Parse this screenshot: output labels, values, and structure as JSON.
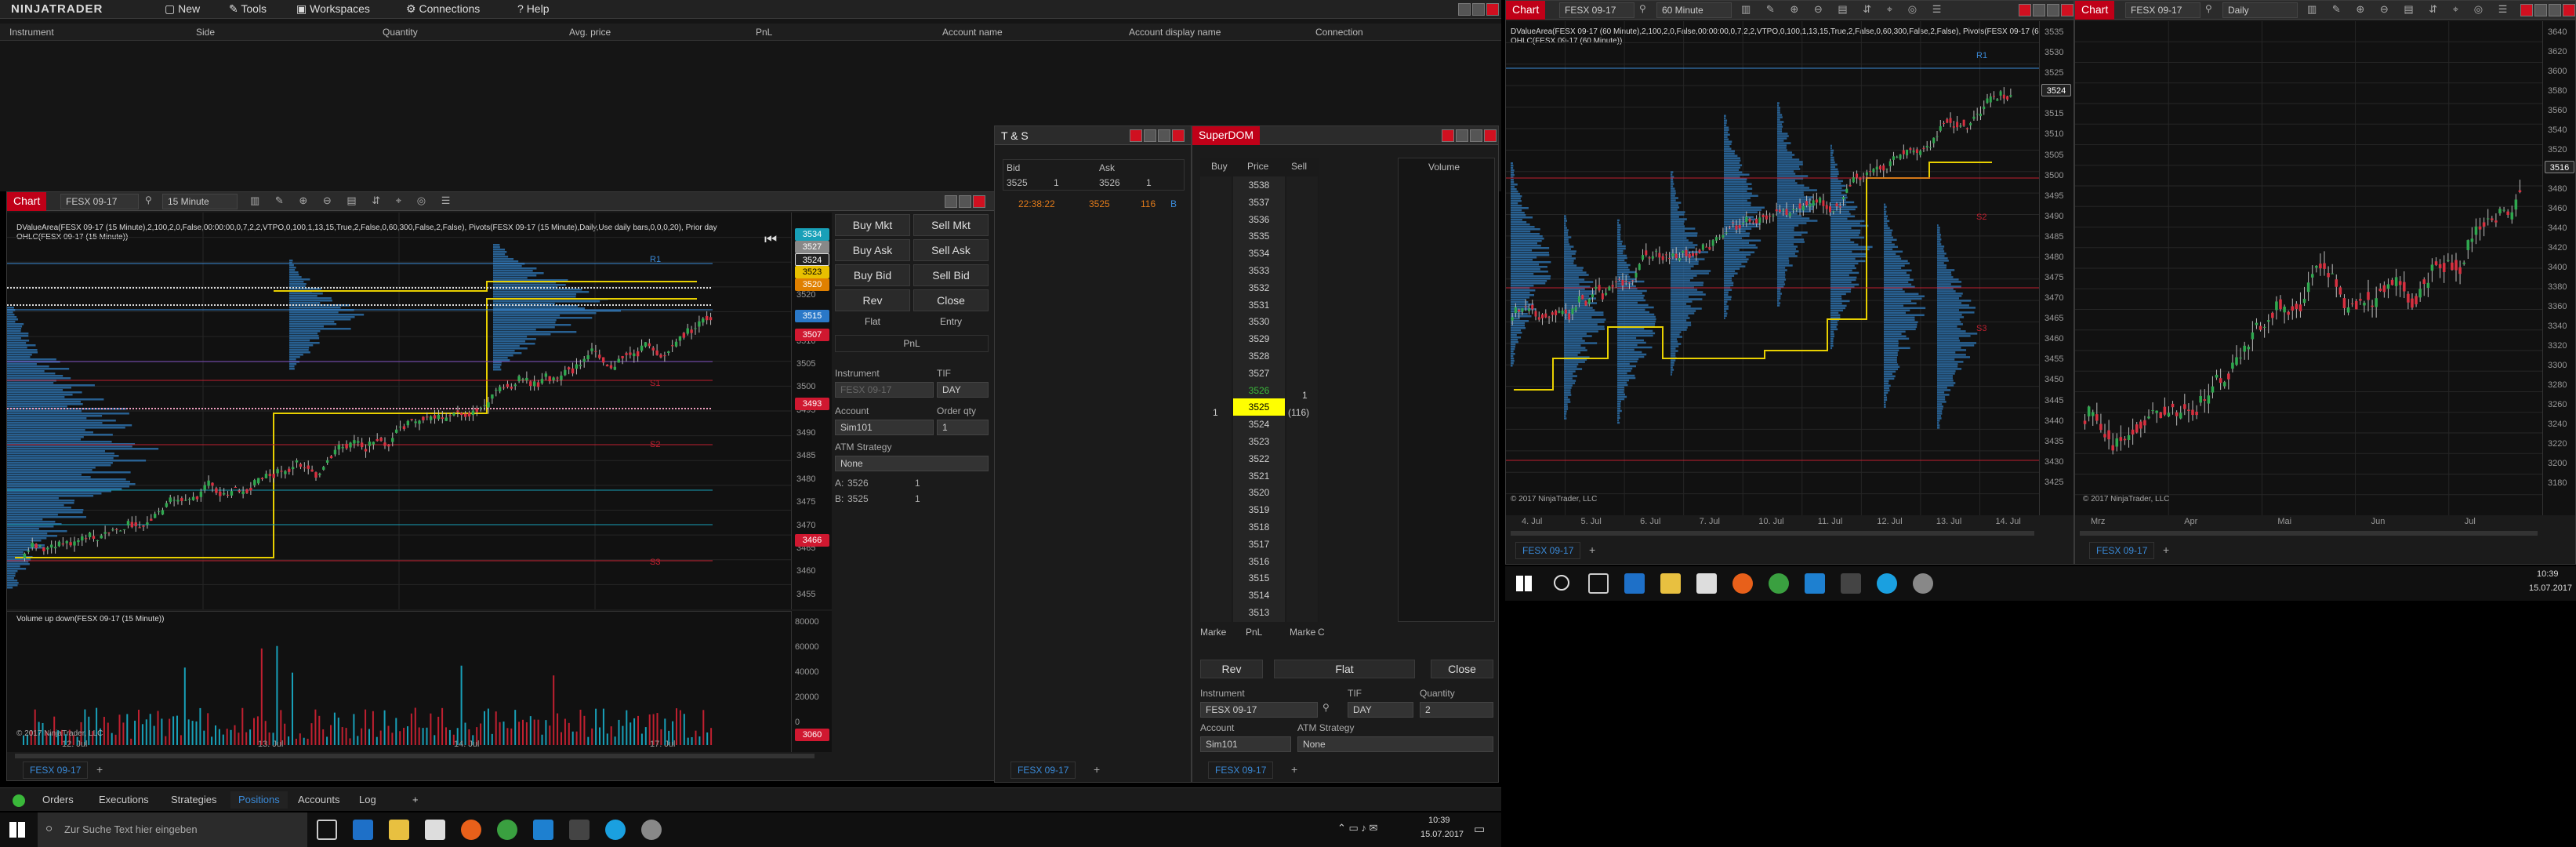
{
  "menu": {
    "brand": "NINJATRADER",
    "items": [
      "New",
      "Tools",
      "Workspaces",
      "Connections",
      "Help"
    ]
  },
  "positions": {
    "columns": [
      "Instrument",
      "Side",
      "Quantity",
      "Avg. price",
      "PnL",
      "Account name",
      "Account display name",
      "Connection"
    ]
  },
  "bottom_tabs": {
    "items": [
      "Orders",
      "Executions",
      "Strategies",
      "Positions",
      "Accounts",
      "Log"
    ],
    "active": "Positions",
    "add": "+"
  },
  "chart1": {
    "title": "Chart",
    "instrument": "FESX 09-17",
    "interval": "15 Minute",
    "indicator_line1": "DValueArea(FESX 09-17 (15 Minute),2,100,2,0,False,00:00:00,0,7,2,2,VTPO,0,100,1,13,15,True,2,False,0,60,300,False,2,False), Pivots(FESX 09-17 (15 Minute),Daily,Use daily bars,0,0,0,20), Prior day",
    "indicator_line2": "OHLC(FESX 09-17 (15 Minute))",
    "copyright": "© 2017 NinjaTrader, LLC",
    "volume_title": "Volume up down(FESX 09-17 (15 Minute))",
    "x_labels": [
      "12. Jul",
      "13. Jul",
      "14. Jul",
      "17. Jul"
    ],
    "y_labels": [
      "3530",
      "3525",
      "3520",
      "3515",
      "3510",
      "3505",
      "3500",
      "3495",
      "3490",
      "3485",
      "3480",
      "3475",
      "3470",
      "3465",
      "3460",
      "3455"
    ],
    "vol_labels": [
      "80000",
      "60000",
      "40000",
      "20000",
      "0"
    ],
    "price_tags": [
      {
        "v": "3534",
        "c": "#18a0b8"
      },
      {
        "v": "3527",
        "c": "#888"
      },
      {
        "v": "3524",
        "c": "#222"
      },
      {
        "v": "3523",
        "c": "#e8c000"
      },
      {
        "v": "3520",
        "c": "#e08000"
      },
      {
        "v": "3515",
        "c": "#2a78c8"
      },
      {
        "v": "3507",
        "c": "#d01830"
      },
      {
        "v": "3493",
        "c": "#d01830"
      },
      {
        "v": "3466",
        "c": "#d01830"
      },
      {
        "v": "3060",
        "c": "#d01830"
      }
    ],
    "pivots": [
      "R1",
      "S1",
      "S2",
      "S3"
    ],
    "tab": "FESX 09-17"
  },
  "order_panel": {
    "buttons": [
      "Buy Mkt",
      "Sell Mkt",
      "Buy Ask",
      "Sell Ask",
      "Buy Bid",
      "Sell Bid",
      "Rev",
      "Close"
    ],
    "flat": "Flat",
    "entry": "Entry",
    "pnl": "PnL",
    "instrument_label": "Instrument",
    "instrument": "FESX 09-17",
    "tif_label": "TIF",
    "tif": "DAY",
    "account_label": "Account",
    "account": "Sim101",
    "qty_label": "Order qty",
    "qty": "1",
    "atm_label": "ATM Strategy",
    "atm": "None",
    "a_label": "A:",
    "a_price": "3526",
    "a_qty": "1",
    "b_label": "B:",
    "b_price": "3525",
    "b_qty": "1"
  },
  "ts": {
    "title": "T & S",
    "bid_label": "Bid",
    "ask_label": "Ask",
    "bid": "3525",
    "bid_size": "1",
    "ask": "3526",
    "ask_size": "1",
    "trade_time": "22:38:22",
    "trade_price": "3525",
    "trade_size": "116",
    "trade_side": "B",
    "tab": "FESX 09-17"
  },
  "superdom": {
    "title": "SuperDOM",
    "buy_label": "Buy",
    "price_label": "Price",
    "sell_label": "Sell",
    "volume_label": "Volume",
    "prices": [
      "3538",
      "3537",
      "3536",
      "3535",
      "3534",
      "3533",
      "3532",
      "3531",
      "3530",
      "3529",
      "3528",
      "3527",
      "3526",
      "3525",
      "3524",
      "3523",
      "3522",
      "3521",
      "3520",
      "3519",
      "3518",
      "3517",
      "3516",
      "3515",
      "3514",
      "3513"
    ],
    "ask_qty": "1",
    "bid_qty": "1",
    "last_vol": "(116)",
    "foot": [
      "Marke",
      "PnL",
      "Marke",
      "C"
    ],
    "rev": "Rev",
    "flat": "Flat",
    "close": "Close",
    "instrument_label": "Instrument",
    "instrument": "FESX 09-17",
    "tif_label": "TIF",
    "tif": "DAY",
    "qty_label": "Quantity",
    "qty": "2",
    "account_label": "Account",
    "account": "Sim101",
    "atm_label": "ATM Strategy",
    "atm": "None",
    "tab": "FESX 09-17"
  },
  "chart2": {
    "title": "Chart",
    "instrument": "FESX 09-17",
    "interval": "60 Minute",
    "indicator_line1": "DValueArea(FESX 09-17 (60 Minute),2,100,2,0,False,00:00:00,0,7,2,2,VTPO,0,100,1,13,15,True,2,False,0,60,300,False,2,False), Pivots(FESX 09-17 (60 Minute),Daily,Use daily bars,0,0,0,20), Prior day",
    "indicator_line2": "OHLC(FESX 09-17 (60 Minute))",
    "copyright": "© 2017 NinjaTrader, LLC",
    "x_labels": [
      "4. Jul",
      "5. Jul",
      "6. Jul",
      "7. Jul",
      "10. Jul",
      "11. Jul",
      "12. Jul",
      "13. Jul",
      "14. Jul"
    ],
    "y_labels": [
      "3535",
      "3530",
      "3525",
      "3520",
      "3515",
      "3510",
      "3505",
      "3500",
      "3495",
      "3490",
      "3485",
      "3480",
      "3475",
      "3470",
      "3465",
      "3460",
      "3455",
      "3450",
      "3445",
      "3440",
      "3435",
      "3430",
      "3425"
    ],
    "price_tag": "3524",
    "pivots": [
      "R1",
      "S2",
      "S3"
    ],
    "tab": "FESX 09-17"
  },
  "chart3": {
    "title": "Chart",
    "instrument": "FESX 09-17",
    "interval": "Daily",
    "copyright": "© 2017 NinjaTrader, LLC",
    "x_labels": [
      "Mrz",
      "Apr",
      "Mai",
      "Jun",
      "Jul"
    ],
    "y_labels": [
      "3640",
      "3620",
      "3600",
      "3580",
      "3560",
      "3540",
      "3520",
      "3500",
      "3480",
      "3460",
      "3440",
      "3420",
      "3400",
      "3380",
      "3360",
      "3340",
      "3320",
      "3300",
      "3280",
      "3260",
      "3240",
      "3220",
      "3200",
      "3180"
    ],
    "price_tag": "3516",
    "tab": "FESX 09-17"
  },
  "taskbar_left": {
    "search_placeholder": "Zur Suche Text hier eingeben",
    "time": "10:39",
    "date": "15.07.2017"
  },
  "taskbar_right": {
    "time": "10:39",
    "date": "15.07.2017"
  }
}
